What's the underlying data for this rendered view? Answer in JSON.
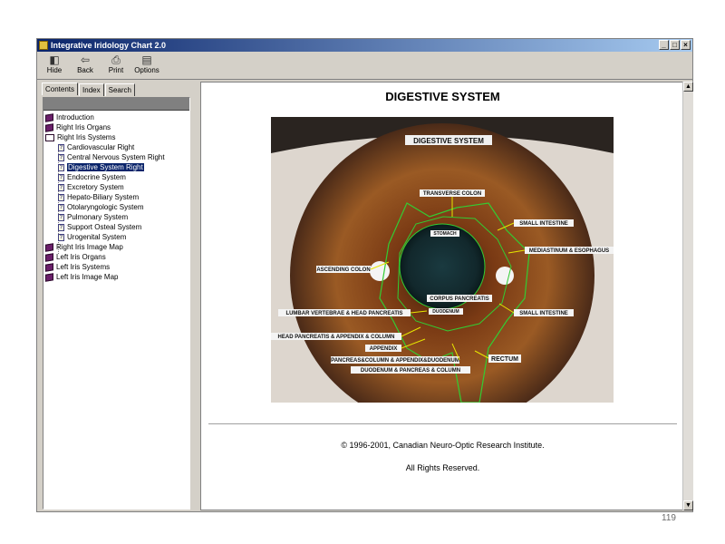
{
  "window": {
    "title": "Integrative Iridology Chart 2.0",
    "controls": [
      "_",
      "□",
      "×"
    ]
  },
  "toolbar": {
    "hide": "Hide",
    "back": "Back",
    "print": "Print",
    "options": "Options"
  },
  "tabs": {
    "contents": "Contents",
    "index": "Index",
    "search": "Search"
  },
  "tree": {
    "introduction": "Introduction",
    "right_organs": "Right Iris Organs",
    "right_systems": "Right Iris Systems",
    "cardio": "Cardiovascular Right",
    "cns": "Central Nervous System Right",
    "digestive": "Digestive System Right",
    "endocrine": "Endocrine System",
    "excretory": "Excretory System",
    "hepato": "Hepato-Biliary System",
    "otolaryn": "Otolaryngologic System",
    "pulmonary": "Pulmonary System",
    "osteal": "Support Osteal System",
    "urogenital": "Urogenital  System",
    "right_map": "Right Iris Image Map",
    "left_organs": "Left Iris Organs",
    "left_systems": "Left Iris Systems",
    "left_map": "Left Iris Image Map"
  },
  "content": {
    "heading": "DIGESTIVE SYSTEM",
    "copyright": "© 1996-2001, Canadian Neuro-Optic Research Institute.",
    "rights": "All Rights Reserved."
  },
  "image_labels": {
    "title": "DIGESTIVE SYSTEM",
    "transverse": "TRANSVERSE COLON",
    "small_int_1": "SMALL INTESTINE",
    "stomach": "STOMACH",
    "mediastinum": "MEDIASTINUM & ESOPHAGUS",
    "ascending": "ASCENDING COLON",
    "corpus": "CORPUS PANCREATIS",
    "duodenum": "DUODENUM",
    "lumbar": "LUMBAR VERTEBRAE & HEAD PANCREATIS",
    "small_int_2": "SMALL INTESTINE",
    "head_pancreas": "HEAD PANCREATIS & APPENDIX & COLUMN",
    "appendix": "APPENDIX",
    "rectum": "RECTUM",
    "pancreas_column": "PANCREAS&COLUMN & APPENDIX&DUODENUM",
    "duodenum_column": "DUODENUM & PANCREAS & COLUMN"
  },
  "page_number": "119",
  "colors": {
    "titlebar": "#0a246a",
    "selection": "#0a246a",
    "iris": "#8a4a1e",
    "zone_lines": "#33cc33",
    "arrows": "#e6e600"
  }
}
